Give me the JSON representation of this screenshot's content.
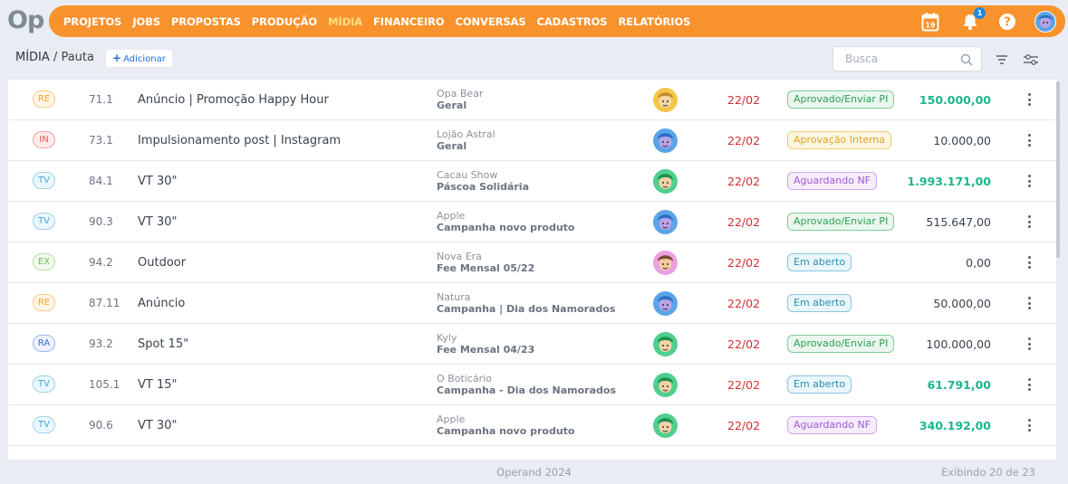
{
  "app": {
    "logo_text": "Op"
  },
  "nav": {
    "items": [
      {
        "label": "PROJETOS",
        "active": false
      },
      {
        "label": "JOBS",
        "active": false
      },
      {
        "label": "PROPOSTAS",
        "active": false
      },
      {
        "label": "PRODUÇÃO",
        "active": false
      },
      {
        "label": "MÍDIA",
        "active": true
      },
      {
        "label": "FINANCEIRO",
        "active": false
      },
      {
        "label": "CONVERSAS",
        "active": false
      },
      {
        "label": "CADASTROS",
        "active": false
      },
      {
        "label": "RELATÓRIOS",
        "active": false
      }
    ],
    "calendar_day": "19",
    "notification_count": "1"
  },
  "header": {
    "breadcrumb_main": "MÍDIA",
    "breadcrumb_sep": " / ",
    "breadcrumb_sub": "Pauta",
    "add_label": "Adicionar",
    "search_placeholder": "Busca"
  },
  "colors": {
    "brand": "#f8922d",
    "date": "#d32f2f",
    "value_green": "#1eb58c",
    "value_default": "#3a4250"
  },
  "rows": [
    {
      "type": "RE",
      "code": "71.1",
      "title": "Anúncio | Promoção Happy Hour",
      "client": "Opa Bear",
      "campaign": "Geral",
      "avatar": "avatar-yellow",
      "date": "22/02",
      "status": "Aprovado/Enviar PI",
      "status_kind": "green",
      "value": "150.000,00",
      "value_green": true
    },
    {
      "type": "IN",
      "code": "73.1",
      "title": "Impulsionamento post | Instagram",
      "client": "Lojão Astral",
      "campaign": "Geral",
      "avatar": "avatar-blue",
      "date": "22/02",
      "status": "Aprovação Interna",
      "status_kind": "yellow",
      "value": "10.000,00",
      "value_green": false
    },
    {
      "type": "TV",
      "code": "84.1",
      "title": "VT 30\"",
      "client": "Cacau Show",
      "campaign": "Páscoa Solidária",
      "avatar": "avatar-green",
      "date": "22/02",
      "status": "Aguardando NF",
      "status_kind": "purple",
      "value": "1.993.171,00",
      "value_green": true
    },
    {
      "type": "TV",
      "code": "90.3",
      "title": "VT 30\"",
      "client": "Apple",
      "campaign": "Campanha novo produto",
      "avatar": "avatar-blue",
      "date": "22/02",
      "status": "Aprovado/Enviar PI",
      "status_kind": "green",
      "value": "515.647,00",
      "value_green": false
    },
    {
      "type": "EX",
      "code": "94.2",
      "title": "Outdoor",
      "client": "Nova Era",
      "campaign": "Fee Mensal 05/22",
      "avatar": "avatar-pink",
      "date": "22/02",
      "status": "Em aberto",
      "status_kind": "teal",
      "value": "0,00",
      "value_green": false
    },
    {
      "type": "RE",
      "code": "87.11",
      "title": "Anúncio",
      "client": "Natura",
      "campaign": "Campanha | Dia dos Namorados",
      "avatar": "avatar-blue",
      "date": "22/02",
      "status": "Em aberto",
      "status_kind": "teal",
      "value": "50.000,00",
      "value_green": false
    },
    {
      "type": "RA",
      "code": "93.2",
      "title": "Spot 15\"",
      "client": "Kyly",
      "campaign": "Fee Mensal 04/23",
      "avatar": "avatar-green",
      "date": "22/02",
      "status": "Aprovado/Enviar PI",
      "status_kind": "green",
      "value": "100.000,00",
      "value_green": false
    },
    {
      "type": "TV",
      "code": "105.1",
      "title": "VT 15\"",
      "client": "O Boticário",
      "campaign": "Campanha - Dia dos Namorados",
      "avatar": "avatar-green",
      "date": "22/02",
      "status": "Em aberto",
      "status_kind": "teal",
      "value": "61.791,00",
      "value_green": true
    },
    {
      "type": "TV",
      "code": "90.6",
      "title": "VT 30\"",
      "client": "Apple",
      "campaign": "Campanha novo produto",
      "avatar": "avatar-green",
      "date": "22/02",
      "status": "Aguardando NF",
      "status_kind": "purple",
      "value": "340.192,00",
      "value_green": true
    }
  ],
  "footer": {
    "copyright": "Operand 2024",
    "count": "Exibindo 20 de 23"
  }
}
